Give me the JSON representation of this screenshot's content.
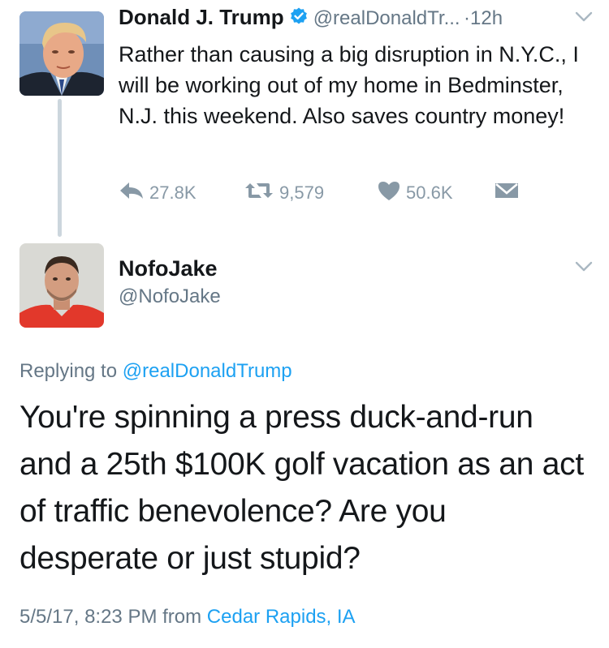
{
  "tweet1": {
    "name": "Donald J. Trump",
    "handle": "@realDonaldTr...",
    "time": "·12h",
    "text": "Rather than causing a big disruption in N.Y.C., I will be working out of my home in Bedminster, N.J. this weekend. Also saves country money!",
    "replies": "27.8K",
    "retweets": "9,579",
    "likes": "50.6K"
  },
  "tweet2": {
    "name": "NofoJake",
    "handle": "@NofoJake",
    "replying_prefix": "Replying to",
    "replying_to": "@realDonaldTrump",
    "text": "You're spinning a press duck-and-run and a 25th $100K golf vacation as an act of traffic benevolence? Are you desperate or just stupid?",
    "timestamp": "5/5/17, 8:23 PM",
    "from_label": "from",
    "location": "Cedar Rapids, IA"
  },
  "colors": {
    "link": "#1da1f2",
    "secondary": "#657786",
    "action_gray": "#8899a6",
    "thread_line": "#ccd6dd"
  },
  "icons": [
    "verified-icon",
    "chevron-down-icon",
    "reply-icon",
    "retweet-icon",
    "heart-icon",
    "direct-message-icon"
  ]
}
